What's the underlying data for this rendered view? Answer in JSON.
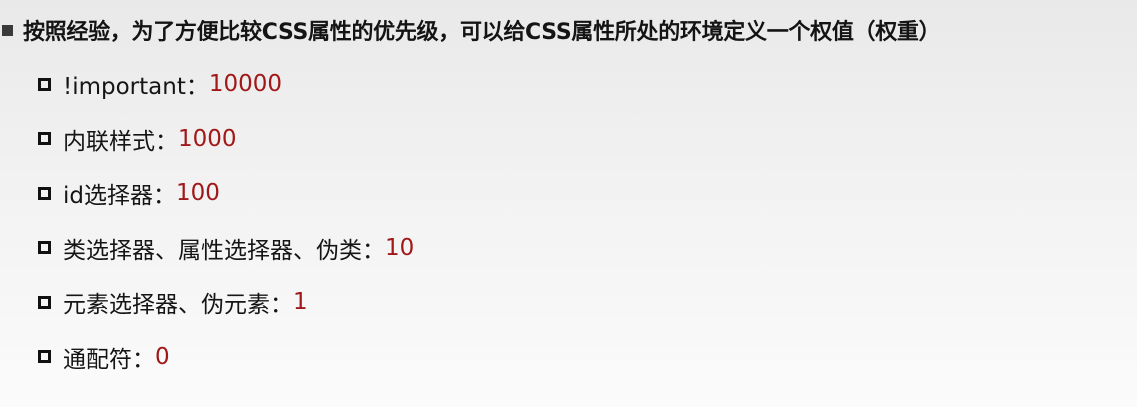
{
  "heading": {
    "text": "按照经验，为了方便比较CSS属性的优先级，可以给CSS属性所处的环境定义一个权值（权重）"
  },
  "items": [
    {
      "label": "!important：",
      "value": "10000"
    },
    {
      "label": "内联样式：",
      "value": "1000"
    },
    {
      "label": "id选择器：",
      "value": "100"
    },
    {
      "label": "类选择器、属性选择器、伪类：",
      "value": "10"
    },
    {
      "label": "元素选择器、伪元素：",
      "value": "1"
    },
    {
      "label": "通配符：",
      "value": "0"
    }
  ],
  "colors": {
    "text": "#111111",
    "value": "#a11818",
    "background": "#f2f2f2"
  }
}
